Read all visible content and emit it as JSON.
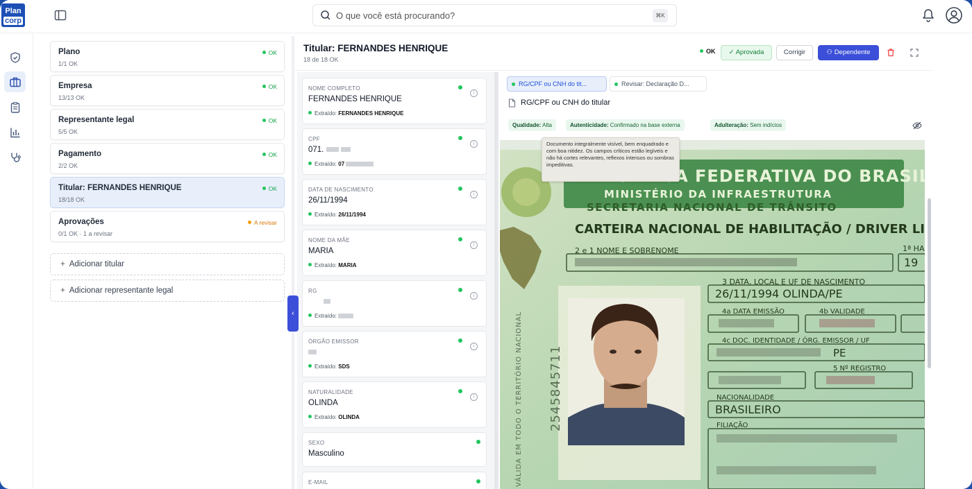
{
  "logo": {
    "line1": "Plan",
    "line2": "corp"
  },
  "search": {
    "placeholder": "O que você está procurando?",
    "shortcut": "⌘K"
  },
  "sections": [
    {
      "title": "Plano",
      "subtitle": "1/1 OK",
      "status": "OK",
      "state": "ok"
    },
    {
      "title": "Empresa",
      "subtitle": "13/13 OK",
      "status": "OK",
      "state": "ok"
    },
    {
      "title": "Representante legal",
      "subtitle": "5/5 OK",
      "status": "OK",
      "state": "ok"
    },
    {
      "title": "Pagamento",
      "subtitle": "2/2 OK",
      "status": "OK",
      "state": "ok"
    },
    {
      "title": "Titular: FERNANDES HENRIQUE",
      "subtitle": "18/18 OK",
      "status": "OK",
      "state": "ok",
      "selected": true
    },
    {
      "title": "Aprovações",
      "subtitle": "0/1 OK · 1 a revisar",
      "status": "A revisar",
      "state": "warn"
    }
  ],
  "add_actions": {
    "titular": "Adicionar titular",
    "representante": "Adicionar representante legal"
  },
  "detail": {
    "title": "Titular: FERNANDES HENRIQUE",
    "subtitle": "18 de 18 OK",
    "status": "OK",
    "approve_label": "Aprovada",
    "correct_label": "Corrigir",
    "dependent_label": "Dependente"
  },
  "fields": [
    {
      "label": "NOME COMPLETO",
      "value": "FERNANDES HENRIQUE",
      "extracted_label": "Extraído:",
      "extracted": "FERNANDES HENRIQUE"
    },
    {
      "label": "CPF",
      "value": "071.",
      "extracted_label": "Extraído:",
      "extracted": "07"
    },
    {
      "label": "DATA DE NASCIMENTO",
      "value": "26/11/1994",
      "extracted_label": "Extraído:",
      "extracted": "26/11/1994"
    },
    {
      "label": "NOME DA MÃE",
      "value": "MARIA",
      "extracted_label": "Extraído:",
      "extracted": "MARIA"
    },
    {
      "label": "RG",
      "value": "",
      "extracted_label": "Extraído:",
      "extracted": ""
    },
    {
      "label": "ÓRGÃO EMISSOR",
      "value": "",
      "extracted_label": "Extraído:",
      "extracted": "SDS"
    },
    {
      "label": "NATURALIDADE",
      "value": "OLINDA",
      "extracted_label": "Extraído:",
      "extracted": "OLINDA"
    },
    {
      "label": "SEXO",
      "value": "Masculino"
    },
    {
      "label": "E-MAIL",
      "value": ""
    }
  ],
  "doc_tabs": [
    {
      "label": "RG/CPF ou CNH do tit...",
      "active": true
    },
    {
      "label": "Revisar: Declaração D...",
      "active": false
    }
  ],
  "document": {
    "title": "RG/CPF ou CNH do titular",
    "chips": [
      {
        "key": "Qualidade:",
        "value": "Alta"
      },
      {
        "key": "Autenticidade:",
        "value": "Confirmado na base externa"
      },
      {
        "key": "Adulteração:",
        "value": "Sem indícios"
      }
    ],
    "tooltip": "Documento integralmente visível, bem enquadrado e com boa nitidez. Os campos críticos estão legíveis e não há cortes relevantes, reflexos intensos ou sombras impeditivas."
  },
  "license": {
    "republic": "REPÚBLICA FEDERATIVA DO BRASIL",
    "ministry": "MINISTÉRIO DA INFRAESTRUTURA",
    "secretariat": "SECRETARIA NACIONAL DE TRÂNSITO",
    "doc_name": "CARTEIRA NACIONAL DE HABILITAÇÃO / DRIVER LICENSE / PERMISO DE C",
    "name_label": "2 e 1 NOME E SOBRENOME",
    "first_hab_label": "1ª HA",
    "first_hab_value": "19",
    "birth_label": "3 DATA, LOCAL E UF DE NASCIMENTO",
    "birth_value": "26/11/1994 OLINDA/PE",
    "issue_label": "4a DATA EMISSÃO",
    "validity_label": "4b VALIDADE",
    "id_label": "4c DOC. IDENTIDADE / ÓRG. EMISSOR / UF",
    "id_uf": "PE",
    "registro_label": "5 Nº REGISTRO",
    "nationality_label": "NACIONALIDADE",
    "nationality_value": "BRASILEIRO",
    "filiation_label": "FILIAÇÃO",
    "side_number": "2545845711",
    "side_text": "VÁLIDA EM TODO O TERRITÓRIO NACIONAL"
  },
  "colors": {
    "brand": "#1d4fb6",
    "primary": "#3b4fd8",
    "ok": "#22c55e",
    "warn": "#f59e0b"
  }
}
